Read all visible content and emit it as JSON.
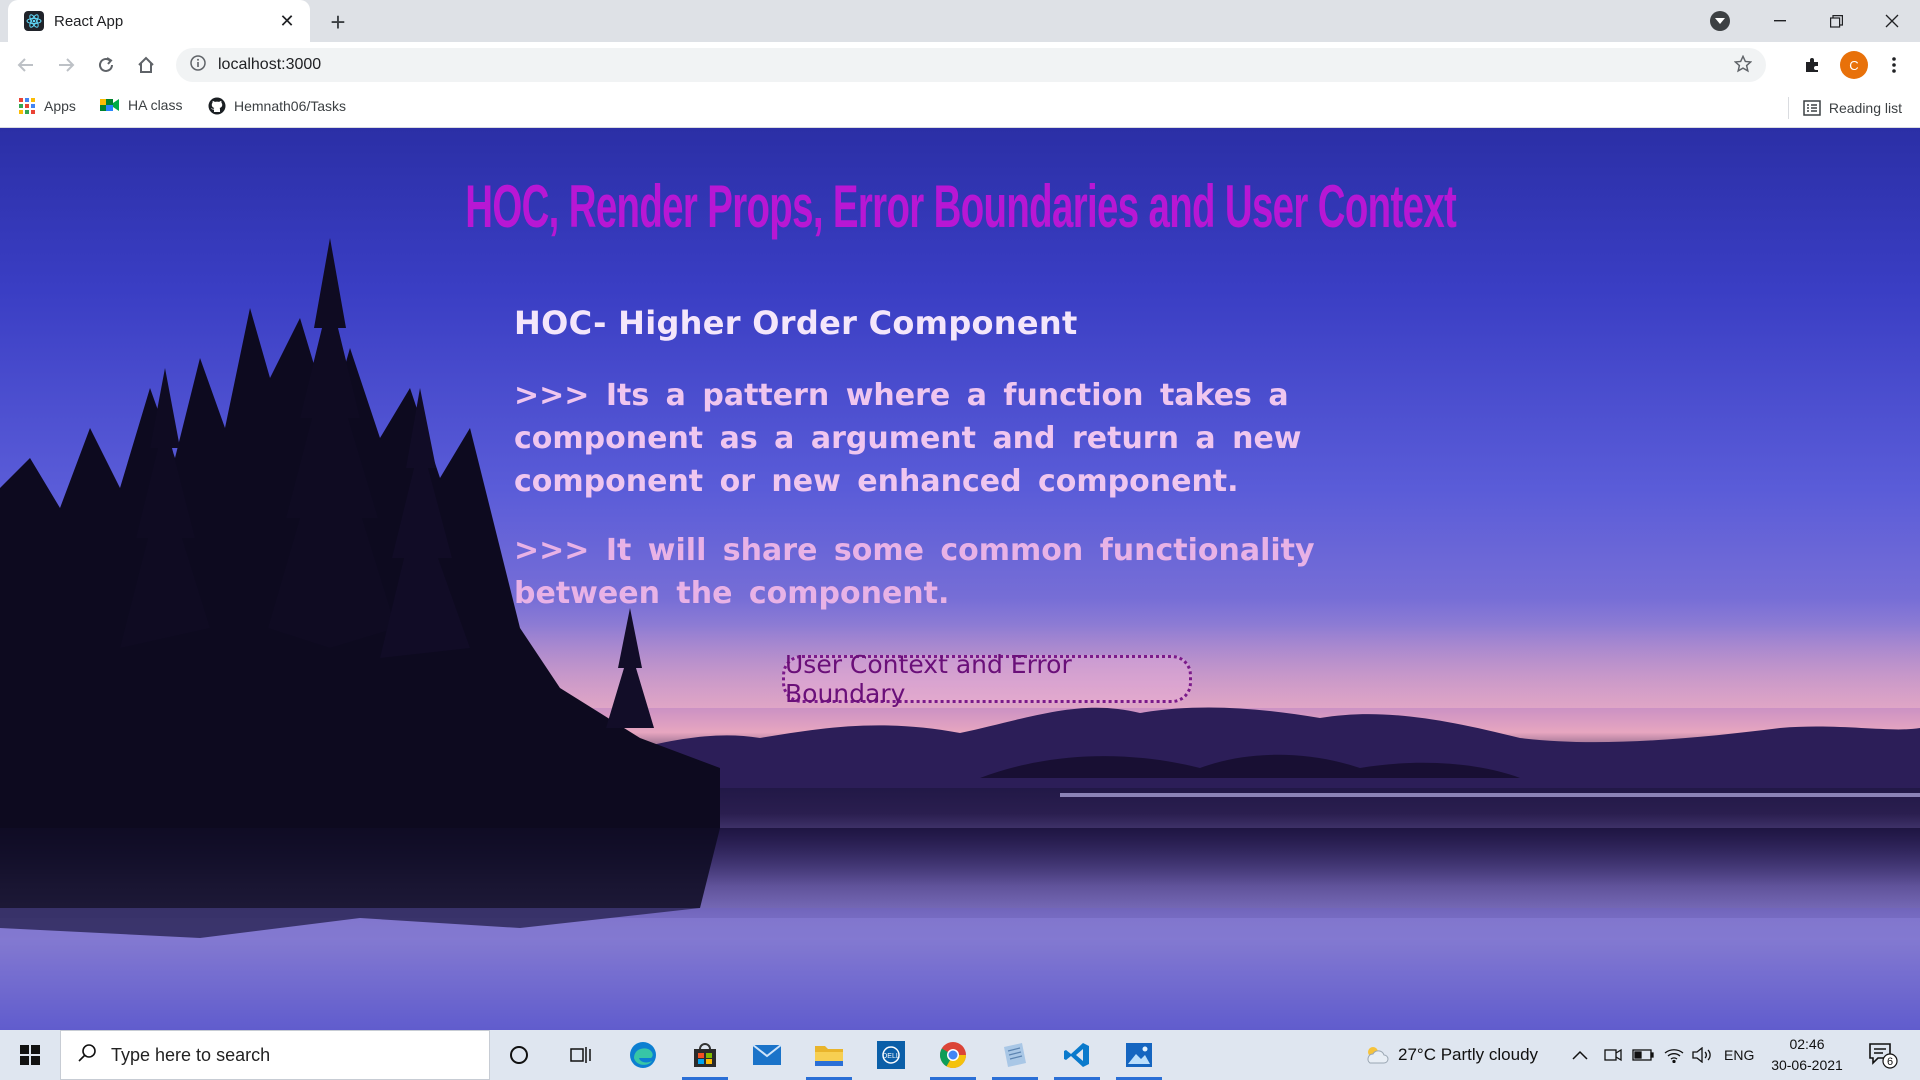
{
  "browser": {
    "tab_title": "React App",
    "url": "localhost:3000",
    "profile_initial": "C",
    "bookmarks": [
      "Apps",
      "HA class",
      "Hemnath06/Tasks"
    ],
    "reading_list": "Reading list"
  },
  "page": {
    "heading": "HOC, Render Props, Error Boundaries and User Context",
    "subheading": "HOC- Higher Order Component",
    "paragraphs": [
      ">>> Its a pattern where a function takes a component as a argument and return a new component or new enhanced component.",
      ">>> It will share some common functionality between the component."
    ],
    "button_label": "User Context and Error Boundary"
  },
  "taskbar": {
    "search_placeholder": "Type here to search",
    "weather": "27°C  Partly cloudy",
    "language": "ENG",
    "time": "02:46",
    "date": "30-06-2021",
    "notification_count": "6"
  },
  "colors": {
    "heading": "#b817d4",
    "text": "#efc6ef",
    "accent": "#e8710a"
  }
}
